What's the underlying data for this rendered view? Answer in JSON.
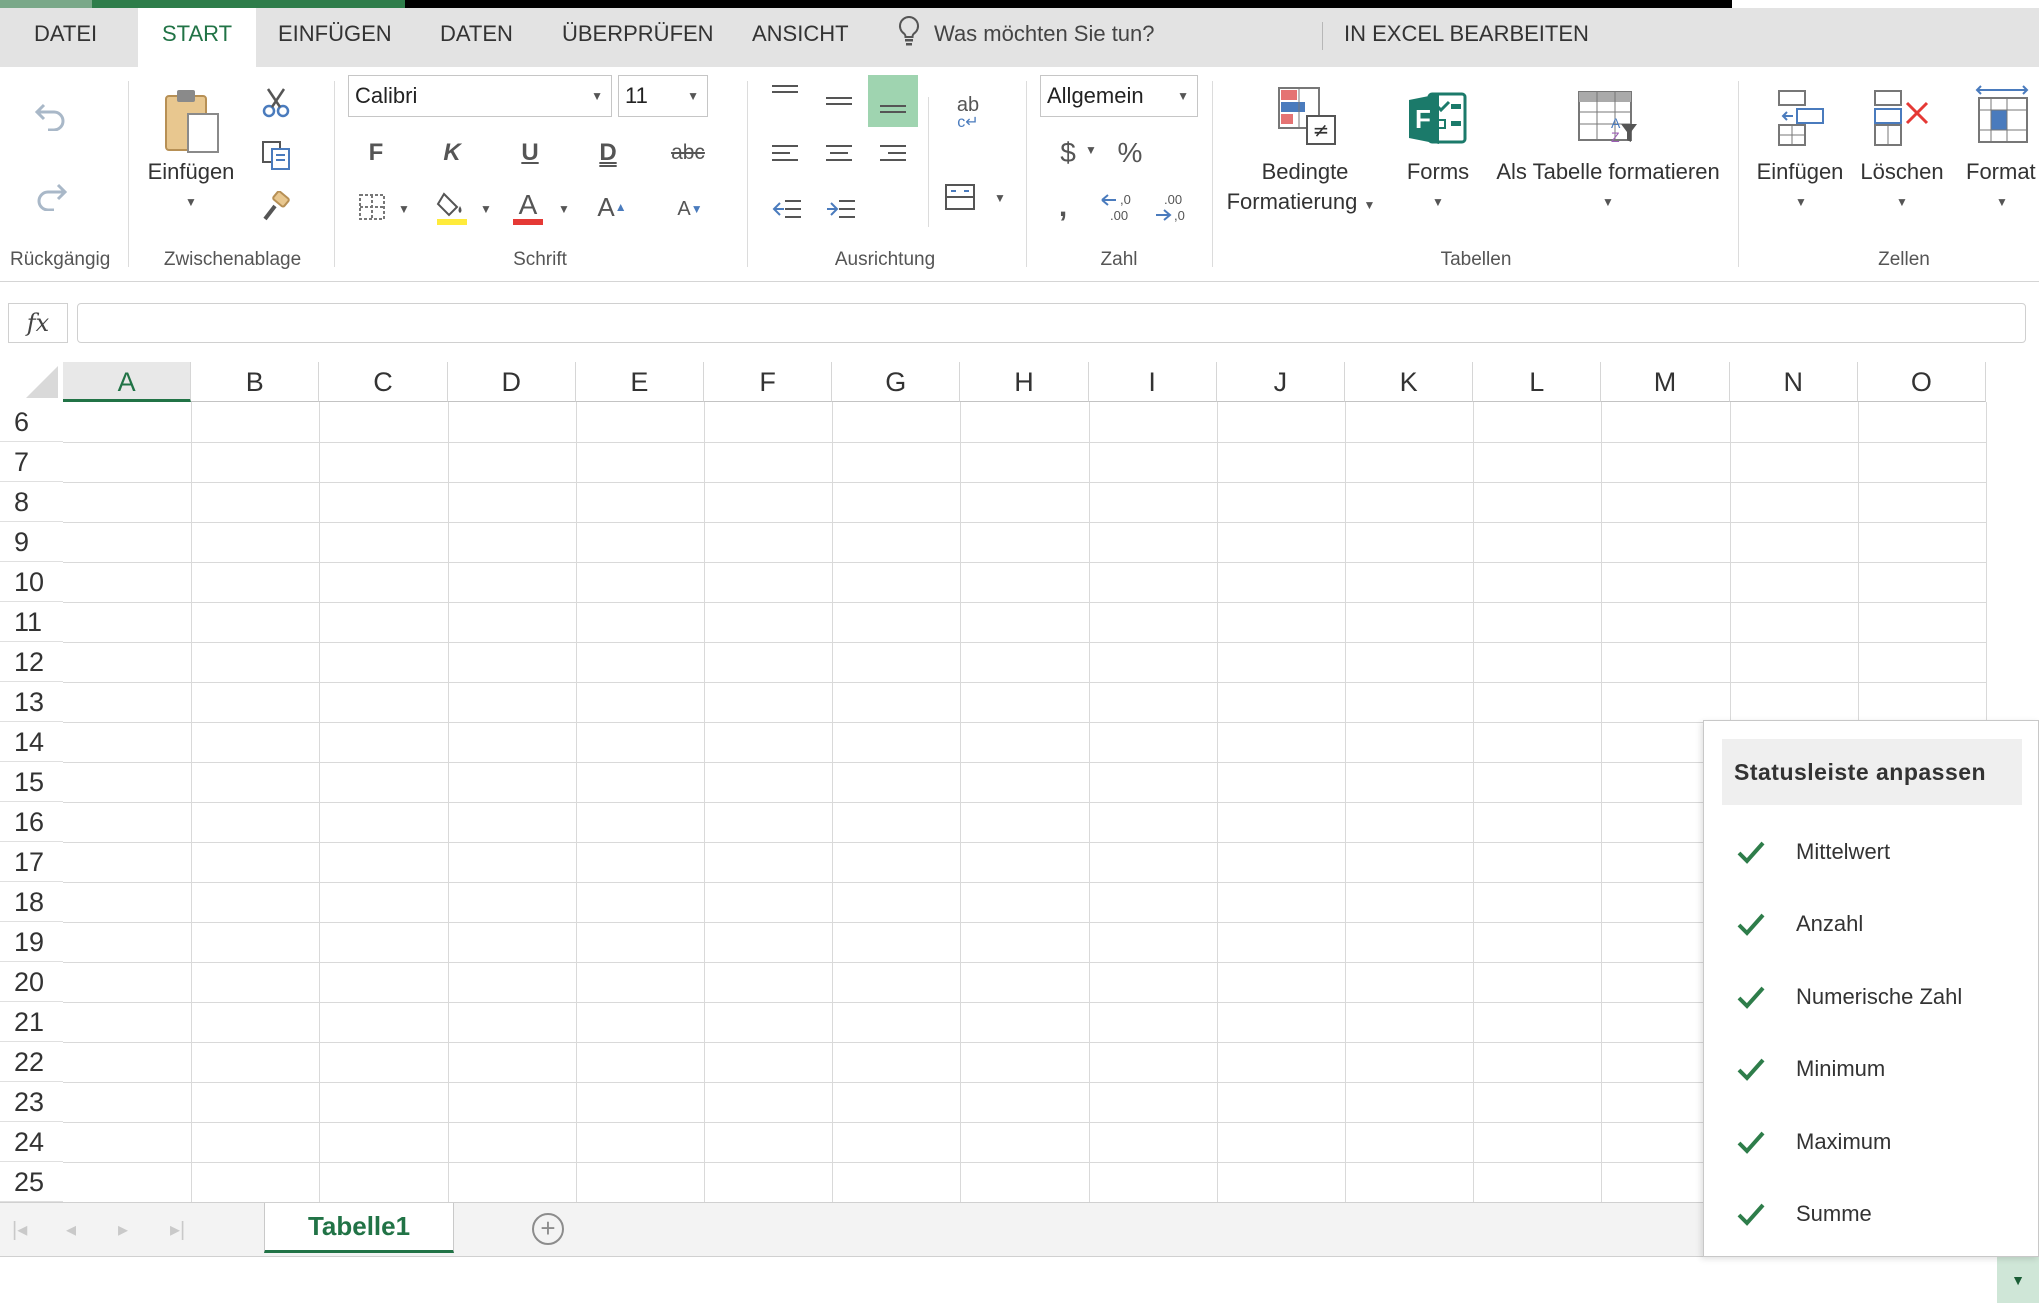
{
  "tabs": {
    "datei": "DATEI",
    "start": "START",
    "einfuegen": "EINFÜGEN",
    "daten": "DATEN",
    "ueberpruefen": "ÜBERPRÜFEN",
    "ansicht": "ANSICHT",
    "excel": "IN EXCEL BEARBEITEN"
  },
  "tellme": {
    "placeholder": "Was möchten Sie tun?",
    "icon": "lightbulb-icon"
  },
  "ribbon": {
    "undo_group": "Rückgängig",
    "clipboard": {
      "group": "Zwischenablage",
      "paste_label": "Einfügen"
    },
    "font": {
      "group": "Schrift",
      "name": "Calibri",
      "size": "11",
      "bold": "F",
      "italic": "K",
      "underline": "U",
      "double_underline": "D",
      "strikethrough": "abc",
      "font_color_glyph": "A",
      "grow": "A",
      "shrink": "A"
    },
    "alignment": {
      "group": "Ausrichtung",
      "wrap_text": "ab"
    },
    "number": {
      "group": "Zahl",
      "format": "Allgemein",
      "currency": "$",
      "percent": "%",
      "comma": ",",
      "inc_dec": "←,0 .00",
      "dec_dec": ".00 →,0"
    },
    "tables": {
      "group": "Tabellen",
      "conditional_line1": "Bedingte",
      "conditional_line2": "Formatierung",
      "forms": "Forms",
      "format_table": "Als Tabelle formatieren"
    },
    "cells": {
      "group": "Zellen",
      "insert": "Einfügen",
      "delete": "Löschen",
      "format": "Format"
    }
  },
  "formula_bar": {
    "fx": "fx",
    "value": ""
  },
  "grid": {
    "columns": [
      "A",
      "B",
      "C",
      "D",
      "E",
      "F",
      "G",
      "H",
      "I",
      "J",
      "K",
      "L",
      "M",
      "N",
      "O"
    ],
    "selected_column": "A",
    "rows": [
      "6",
      "7",
      "8",
      "9",
      "10",
      "11",
      "12",
      "13",
      "14",
      "15",
      "16",
      "17",
      "18",
      "19",
      "20",
      "21",
      "22",
      "23",
      "24",
      "25"
    ]
  },
  "sheets": {
    "active": "Tabelle1",
    "add": "+"
  },
  "status_popup": {
    "title": "Statusleiste anpassen",
    "items": [
      {
        "label": "Mittelwert",
        "checked": true
      },
      {
        "label": "Anzahl",
        "checked": true
      },
      {
        "label": "Numerische Zahl",
        "checked": true
      },
      {
        "label": "Minimum",
        "checked": true
      },
      {
        "label": "Maximum",
        "checked": true
      },
      {
        "label": "Summe",
        "checked": true
      }
    ]
  },
  "colors": {
    "accent": "#217346",
    "check": "#2e7d4a",
    "tabbar": "#e3e3e3"
  }
}
